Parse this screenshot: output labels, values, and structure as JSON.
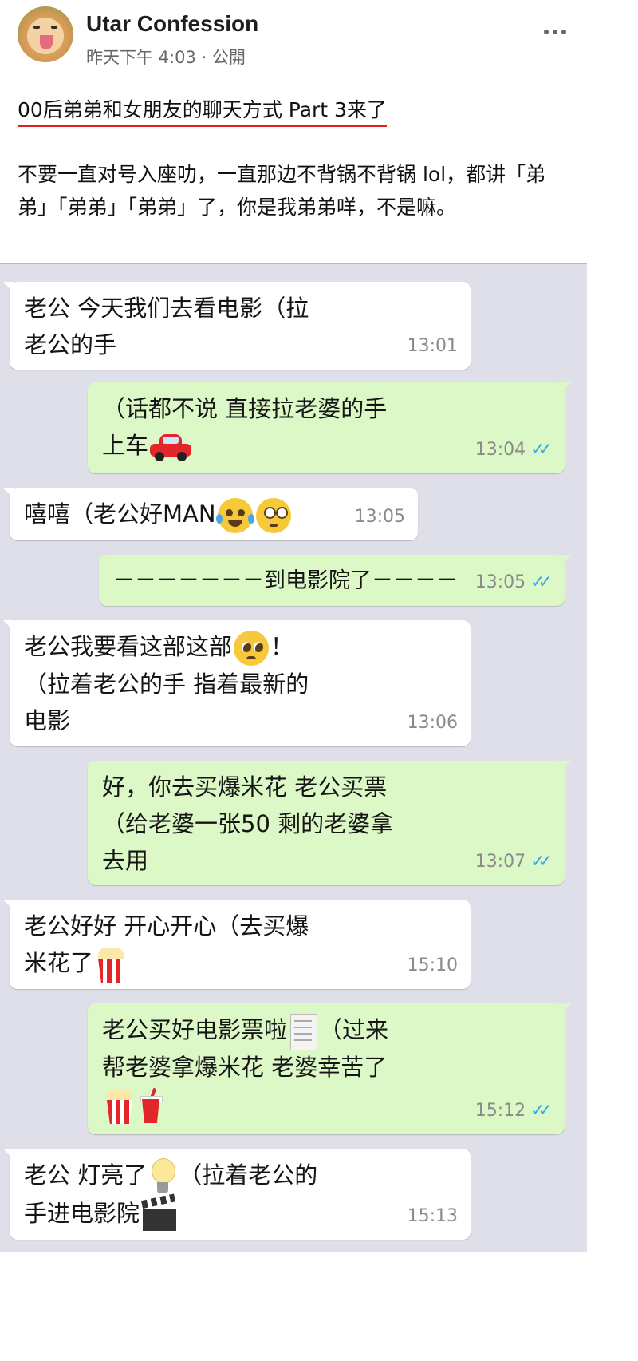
{
  "post": {
    "page_name": "Utar Confession",
    "meta": "昨天下午 4:03 · 公開",
    "title": "00后弟弟和女朋友的聊天方式 Part 3来了",
    "body": "不要一直对号入座叻，一直那边不背锅不背锅 lol，都讲「弟弟」「弟弟」「弟弟」了，你是我弟弟咩，不是嘛。"
  },
  "icons": {
    "avatar": "shiba-dog-avatar",
    "more": "more-options-icon",
    "read_receipt": "double-check-icon"
  },
  "colors": {
    "chat_bg": "#dedfe8",
    "incoming_bubble": "#ffffff",
    "outgoing_bubble": "#dbf8c6",
    "ticks": "#38a9e8",
    "title_underline": "#e0201c"
  },
  "messages": [
    {
      "dir": "in",
      "text": "老公 今天我们去看电影（拉\n老公的手",
      "time": "13:01"
    },
    {
      "dir": "out",
      "text": "（话都不说 直接拉老婆的手\n上车",
      "time": "13:04",
      "read": "✓✓"
    },
    {
      "dir": "in",
      "text": "嘻嘻（老公好MAN",
      "time": "13:05"
    },
    {
      "dir": "out",
      "text": "－－－－－－－到电影院了－－－－",
      "time": "13:05",
      "read": "✓✓"
    },
    {
      "dir": "in",
      "text": "老公我要看这部这部",
      "text2": "！\n（拉着老公的手 指着最新的\n电影",
      "time": "13:06"
    },
    {
      "dir": "out",
      "text": "好，你去买爆米花 老公买票\n（给老婆一张50 剩的老婆拿\n去用",
      "time": "13:07",
      "read": "✓✓"
    },
    {
      "dir": "in",
      "text": "老公好好 开心开心（去买爆\n米花了",
      "time": "15:10"
    },
    {
      "dir": "out",
      "text": "老公买好电影票啦",
      "text2": "（过来\n帮老婆拿爆米花 老婆幸苦了",
      "time": "15:12",
      "read": "✓✓"
    },
    {
      "dir": "in",
      "text": "老公 灯亮了",
      "text2": "（拉着老公的\n手进电影院",
      "time": "15:13"
    }
  ],
  "emoji": {
    "car": "red-car-emoji",
    "laugh": "tears-of-joy-emoji",
    "flushed": "flushed-face-emoji",
    "pleading": "pleading-face-emoji",
    "popcorn": "popcorn-emoji",
    "receipt": "receipt-emoji",
    "drink": "cup-with-straw-emoji",
    "bulb": "light-bulb-emoji",
    "clapper": "clapper-board-emoji"
  }
}
